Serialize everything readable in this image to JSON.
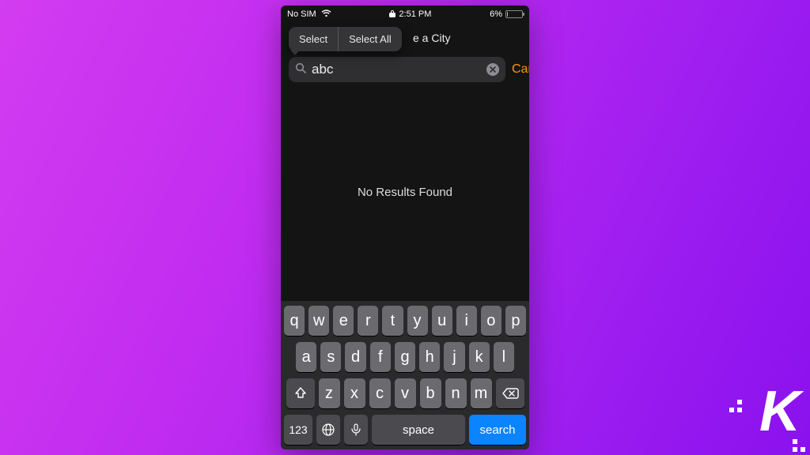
{
  "status": {
    "carrier": "No SIM",
    "time": "2:51 PM",
    "battery_percent": "6%"
  },
  "header": {
    "title_visible": "e a City"
  },
  "popover": {
    "select": "Select",
    "select_all": "Select All"
  },
  "search": {
    "value": "abc",
    "cancel": "Cancel"
  },
  "results": {
    "empty": "No Results Found"
  },
  "keyboard": {
    "row1": [
      "q",
      "w",
      "e",
      "r",
      "t",
      "y",
      "u",
      "i",
      "o",
      "p"
    ],
    "row2": [
      "a",
      "s",
      "d",
      "f",
      "g",
      "h",
      "j",
      "k",
      "l"
    ],
    "row3": [
      "z",
      "x",
      "c",
      "v",
      "b",
      "n",
      "m"
    ],
    "numkey": "123",
    "space": "space",
    "search": "search"
  },
  "logo": {
    "letter": "K"
  }
}
